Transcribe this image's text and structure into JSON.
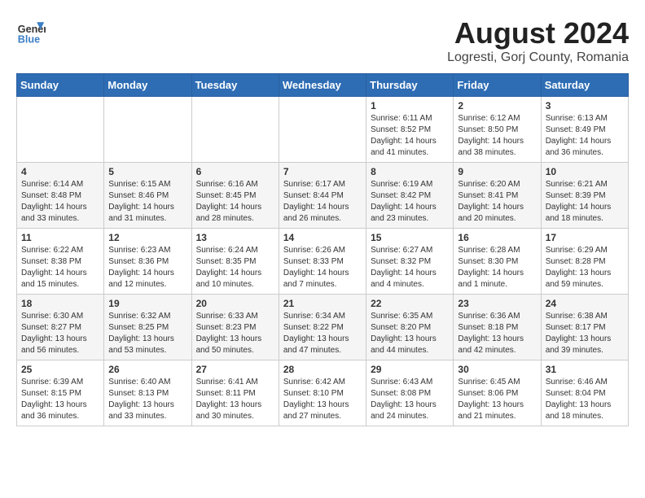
{
  "header": {
    "logo_line1": "General",
    "logo_line2": "Blue",
    "title": "August 2024",
    "subtitle": "Logresti, Gorj County, Romania"
  },
  "days_of_week": [
    "Sunday",
    "Monday",
    "Tuesday",
    "Wednesday",
    "Thursday",
    "Friday",
    "Saturday"
  ],
  "weeks": [
    [
      {
        "day": "",
        "info": ""
      },
      {
        "day": "",
        "info": ""
      },
      {
        "day": "",
        "info": ""
      },
      {
        "day": "",
        "info": ""
      },
      {
        "day": "1",
        "info": "Sunrise: 6:11 AM\nSunset: 8:52 PM\nDaylight: 14 hours and 41 minutes."
      },
      {
        "day": "2",
        "info": "Sunrise: 6:12 AM\nSunset: 8:50 PM\nDaylight: 14 hours and 38 minutes."
      },
      {
        "day": "3",
        "info": "Sunrise: 6:13 AM\nSunset: 8:49 PM\nDaylight: 14 hours and 36 minutes."
      }
    ],
    [
      {
        "day": "4",
        "info": "Sunrise: 6:14 AM\nSunset: 8:48 PM\nDaylight: 14 hours and 33 minutes."
      },
      {
        "day": "5",
        "info": "Sunrise: 6:15 AM\nSunset: 8:46 PM\nDaylight: 14 hours and 31 minutes."
      },
      {
        "day": "6",
        "info": "Sunrise: 6:16 AM\nSunset: 8:45 PM\nDaylight: 14 hours and 28 minutes."
      },
      {
        "day": "7",
        "info": "Sunrise: 6:17 AM\nSunset: 8:44 PM\nDaylight: 14 hours and 26 minutes."
      },
      {
        "day": "8",
        "info": "Sunrise: 6:19 AM\nSunset: 8:42 PM\nDaylight: 14 hours and 23 minutes."
      },
      {
        "day": "9",
        "info": "Sunrise: 6:20 AM\nSunset: 8:41 PM\nDaylight: 14 hours and 20 minutes."
      },
      {
        "day": "10",
        "info": "Sunrise: 6:21 AM\nSunset: 8:39 PM\nDaylight: 14 hours and 18 minutes."
      }
    ],
    [
      {
        "day": "11",
        "info": "Sunrise: 6:22 AM\nSunset: 8:38 PM\nDaylight: 14 hours and 15 minutes."
      },
      {
        "day": "12",
        "info": "Sunrise: 6:23 AM\nSunset: 8:36 PM\nDaylight: 14 hours and 12 minutes."
      },
      {
        "day": "13",
        "info": "Sunrise: 6:24 AM\nSunset: 8:35 PM\nDaylight: 14 hours and 10 minutes."
      },
      {
        "day": "14",
        "info": "Sunrise: 6:26 AM\nSunset: 8:33 PM\nDaylight: 14 hours and 7 minutes."
      },
      {
        "day": "15",
        "info": "Sunrise: 6:27 AM\nSunset: 8:32 PM\nDaylight: 14 hours and 4 minutes."
      },
      {
        "day": "16",
        "info": "Sunrise: 6:28 AM\nSunset: 8:30 PM\nDaylight: 14 hours and 1 minute."
      },
      {
        "day": "17",
        "info": "Sunrise: 6:29 AM\nSunset: 8:28 PM\nDaylight: 13 hours and 59 minutes."
      }
    ],
    [
      {
        "day": "18",
        "info": "Sunrise: 6:30 AM\nSunset: 8:27 PM\nDaylight: 13 hours and 56 minutes."
      },
      {
        "day": "19",
        "info": "Sunrise: 6:32 AM\nSunset: 8:25 PM\nDaylight: 13 hours and 53 minutes."
      },
      {
        "day": "20",
        "info": "Sunrise: 6:33 AM\nSunset: 8:23 PM\nDaylight: 13 hours and 50 minutes."
      },
      {
        "day": "21",
        "info": "Sunrise: 6:34 AM\nSunset: 8:22 PM\nDaylight: 13 hours and 47 minutes."
      },
      {
        "day": "22",
        "info": "Sunrise: 6:35 AM\nSunset: 8:20 PM\nDaylight: 13 hours and 44 minutes."
      },
      {
        "day": "23",
        "info": "Sunrise: 6:36 AM\nSunset: 8:18 PM\nDaylight: 13 hours and 42 minutes."
      },
      {
        "day": "24",
        "info": "Sunrise: 6:38 AM\nSunset: 8:17 PM\nDaylight: 13 hours and 39 minutes."
      }
    ],
    [
      {
        "day": "25",
        "info": "Sunrise: 6:39 AM\nSunset: 8:15 PM\nDaylight: 13 hours and 36 minutes."
      },
      {
        "day": "26",
        "info": "Sunrise: 6:40 AM\nSunset: 8:13 PM\nDaylight: 13 hours and 33 minutes."
      },
      {
        "day": "27",
        "info": "Sunrise: 6:41 AM\nSunset: 8:11 PM\nDaylight: 13 hours and 30 minutes."
      },
      {
        "day": "28",
        "info": "Sunrise: 6:42 AM\nSunset: 8:10 PM\nDaylight: 13 hours and 27 minutes."
      },
      {
        "day": "29",
        "info": "Sunrise: 6:43 AM\nSunset: 8:08 PM\nDaylight: 13 hours and 24 minutes."
      },
      {
        "day": "30",
        "info": "Sunrise: 6:45 AM\nSunset: 8:06 PM\nDaylight: 13 hours and 21 minutes."
      },
      {
        "day": "31",
        "info": "Sunrise: 6:46 AM\nSunset: 8:04 PM\nDaylight: 13 hours and 18 minutes."
      }
    ]
  ]
}
